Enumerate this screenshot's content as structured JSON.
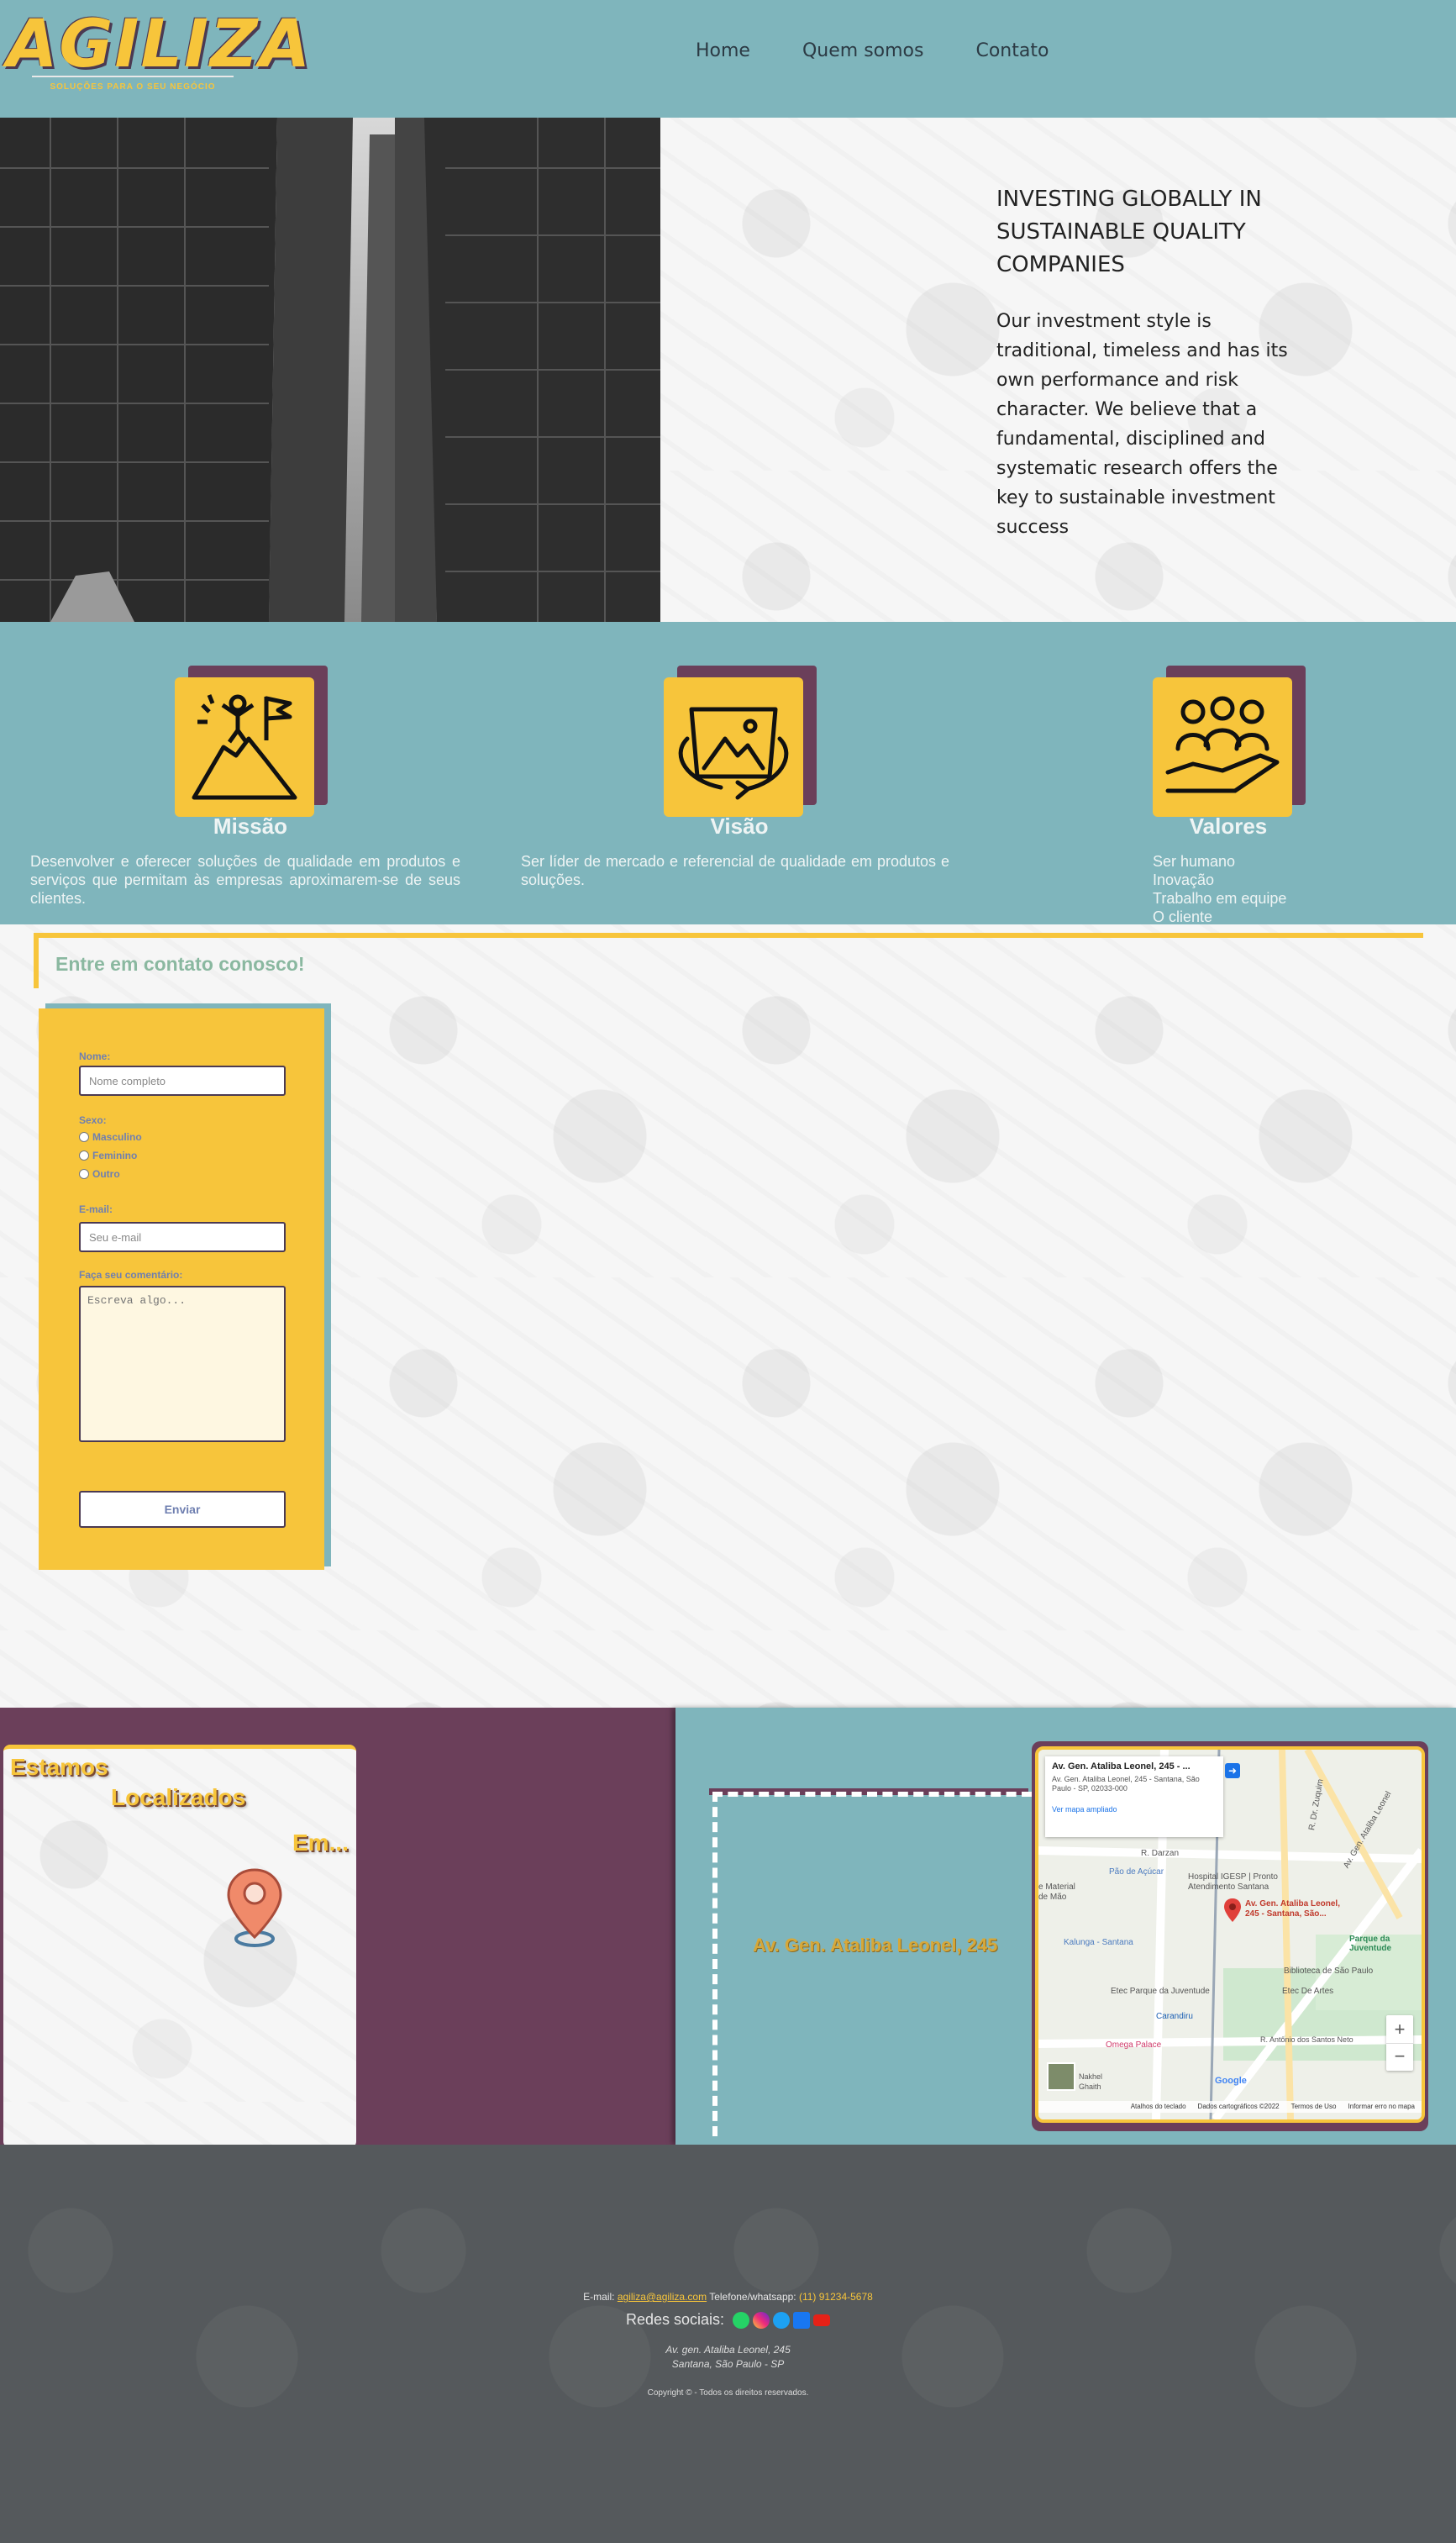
{
  "brand": {
    "logo_text": "AGILIZA",
    "tagline": "SOLUÇÕES PARA O SEU NEGÓCIO"
  },
  "nav": {
    "items": [
      "Home",
      "Quem somos",
      "Contato"
    ]
  },
  "hero": {
    "title": "INVESTING GLOBALLY IN SUSTAINABLE QUALITY COMPANIES",
    "body": "Our investment style is traditional, timeless and has its own performance and risk character. We believe that a fundamental, disciplined and systematic research offers the key to sustainable investment success"
  },
  "values": {
    "missao": {
      "title": "Missão",
      "text": "Desenvolver e oferecer soluções de qualidade em produtos e serviços que permitam às empresas aproximarem-se de seus clientes."
    },
    "visao": {
      "title": "Visão",
      "text": "Ser líder de mercado e referencial de qualidade em produtos e soluções."
    },
    "valores": {
      "title": "Valores",
      "items": [
        "Ser humano",
        "Inovação",
        "Trabalho em equipe",
        "O cliente"
      ]
    }
  },
  "contact": {
    "title": "Entre em contato conosco!",
    "name_label": "Nome:",
    "name_placeholder": "Nome completo",
    "sex_label": "Sexo:",
    "sex_options": [
      "Masculino",
      "Feminino",
      "Outro"
    ],
    "email_label": "E-mail:",
    "email_placeholder": "Seu e-mail",
    "comment_label": "Faça seu comentário:",
    "comment_placeholder": "Escreva algo...",
    "submit_label": "Enviar"
  },
  "location": {
    "word1": "Estamos",
    "word2": "Localizados",
    "word3": "Em...",
    "address": "Av. Gen. Ataliba Leonel, 245",
    "map": {
      "card_title": "Av. Gen. Ataliba Leonel, 245 - ...",
      "card_address": "Av. Gen. Ataliba Leonel, 245 - Santana, São Paulo - SP, 02033-000",
      "card_link": "Ver mapa ampliado",
      "pin_label": "Av. Gen. Ataliba Leonel, 245 - Santana, São...",
      "places": [
        "Pão de Açúcar",
        "Hospital IGESP | Pronto Atendimento Santana",
        "Kalunga - Santana",
        "Parque da Juventude",
        "Biblioteca de São Paulo",
        "Etec Parque da Juventude",
        "Etec De Artes",
        "Carandiru",
        "Omega Palace",
        "R. Darzan",
        "R. Dr. Zuquim",
        "Av. Gen. Ataliba Leonel",
        "R. Antônio dos Santos Neto",
        "e Material",
        "de Mão",
        "Nakhel",
        "Ghaith"
      ],
      "footer_items": [
        "Atalhos do teclado",
        "Dados cartográficos ©2022",
        "Termos de Uso",
        "Informar erro no mapa"
      ],
      "google_label": "Google"
    }
  },
  "footer": {
    "email_label": "E-mail:",
    "email": "agiliza@agiliza.com",
    "phone_label": "Telefone/whatsapp:",
    "phone": "(11) 91234-5678",
    "social_label": "Redes sociais:",
    "address_line1": "Av. gen. Ataliba Leonel, 245",
    "address_line2": "Santana, São Paulo - SP",
    "copyright": "Copyright © - Todos os direitos reservados."
  }
}
